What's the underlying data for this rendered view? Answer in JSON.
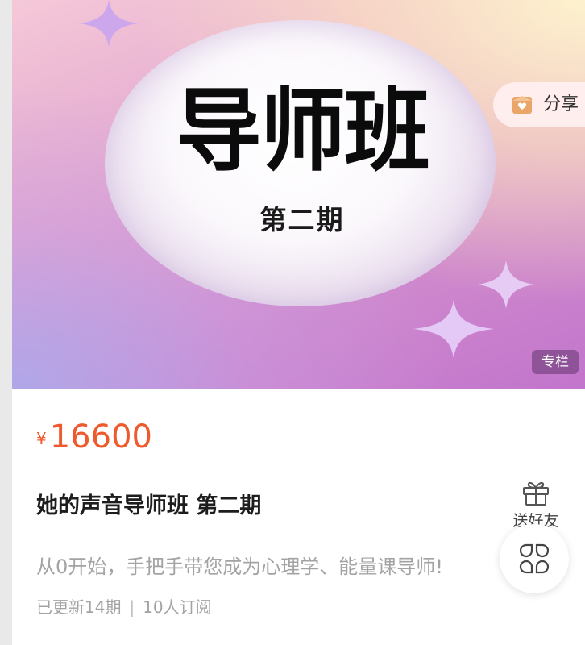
{
  "banner": {
    "title": "导师班",
    "subtitle": "第二期",
    "share_label": "分享",
    "tag": "专栏"
  },
  "product": {
    "currency": "¥",
    "price": "16600",
    "title": "她的声音导师班 第二期",
    "description": "从0开始，手把手带您成为心理学、能量课导师!",
    "updated": "已更新14期",
    "separator": "|",
    "subscribers": "10人订阅"
  },
  "actions": {
    "gift_label": "送好友",
    "gift_icon": "gift-icon",
    "share_icon": "share-icon",
    "menu_icon": "grid-menu-icon"
  },
  "colors": {
    "price": "#ef5a2d",
    "tag_background": "#6e3c78",
    "title": "#1d1d1d",
    "muted": "#a3a3a3"
  }
}
